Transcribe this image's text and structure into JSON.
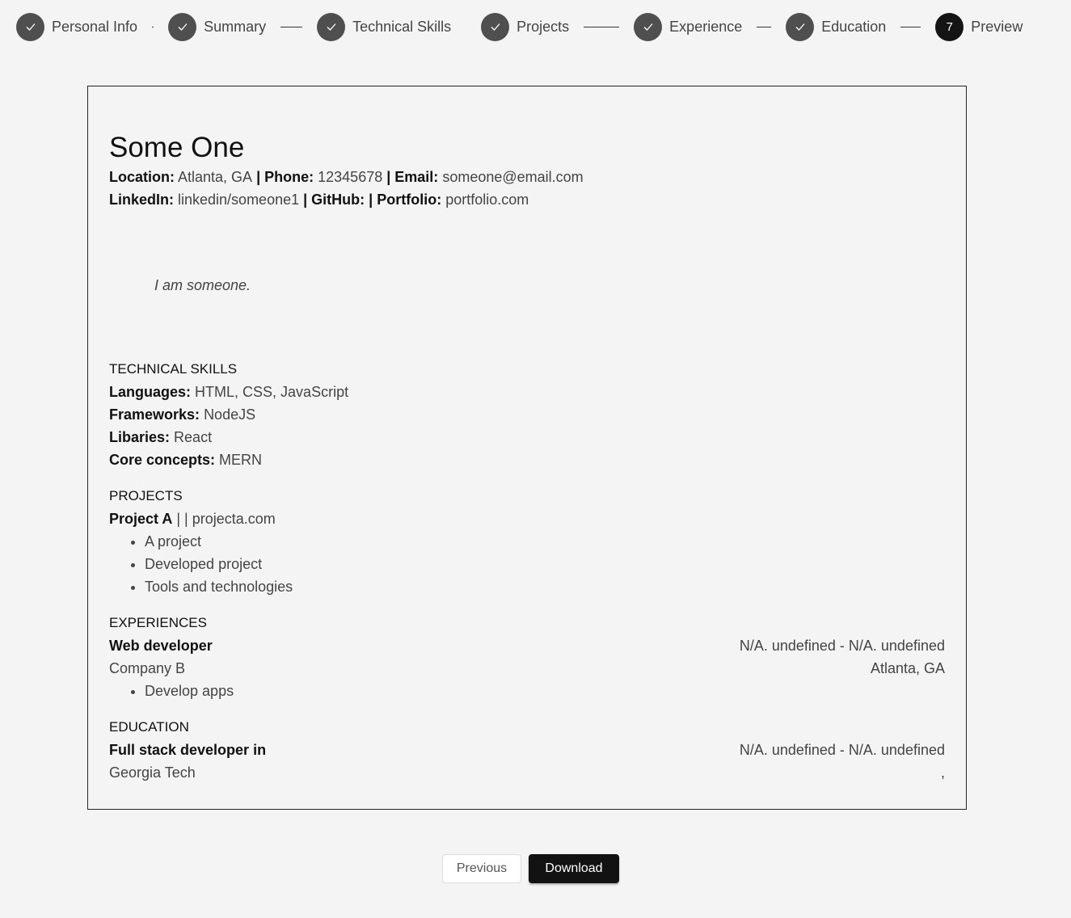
{
  "stepper": {
    "steps": [
      {
        "label": "Personal Info",
        "status": "done"
      },
      {
        "label": "Summary",
        "status": "done"
      },
      {
        "label": "Technical Skills",
        "status": "done"
      },
      {
        "label": "Projects",
        "status": "done"
      },
      {
        "label": "Experience",
        "status": "done"
      },
      {
        "label": "Education",
        "status": "done"
      },
      {
        "label": "Preview",
        "status": "active",
        "number": "7"
      }
    ]
  },
  "resume": {
    "name": "Some One",
    "contact": {
      "location_label": "Location:",
      "location": "Atlanta, GA",
      "sep1": " | ",
      "phone_label": "Phone:",
      "phone": "12345678",
      "sep2": " | ",
      "email_label": "Email:",
      "email": "someone@email.com",
      "linkedin_label": "LinkedIn:",
      "linkedin": "linkedin/someone1",
      "sep3": " | ",
      "github_label": "GitHub:",
      "github": "",
      "sep4": " | ",
      "portfolio_label": "Portfolio:",
      "portfolio": "portfolio.com"
    },
    "summary": "I am someone.",
    "skills": {
      "title": "TECHNICAL SKILLS",
      "languages_label": "Languages:",
      "languages": "HTML, CSS, JavaScript",
      "frameworks_label": "Frameworks:",
      "frameworks": "NodeJS",
      "libraries_label": "Libaries:",
      "libraries": "React",
      "core_label": "Core concepts:",
      "core": "MERN"
    },
    "projects": {
      "title": "PROJECTS",
      "items": [
        {
          "name": "Project A",
          "separator": " | | ",
          "link": "projecta.com",
          "bullets": [
            "A project",
            "Developed project",
            "Tools and technologies"
          ]
        }
      ]
    },
    "experiences": {
      "title": "EXPERIENCES",
      "items": [
        {
          "role": "Web developer",
          "dates": "N/A. undefined - N/A. undefined",
          "company": "Company B",
          "location": "Atlanta, GA",
          "bullets": [
            "Develop apps"
          ]
        }
      ]
    },
    "education": {
      "title": "EDUCATION",
      "items": [
        {
          "degree": "Full stack developer in",
          "dates": "N/A. undefined - N/A. undefined",
          "school": "Georgia Tech",
          "location": ","
        }
      ]
    }
  },
  "actions": {
    "previous_label": "Previous",
    "download_label": "Download"
  }
}
